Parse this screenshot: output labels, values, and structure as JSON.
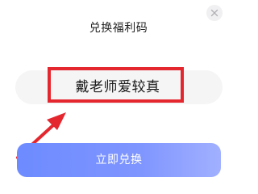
{
  "dialog": {
    "title": "兑换福利码",
    "close_icon": "close-icon"
  },
  "code_input": {
    "value": "戴老师爱较真"
  },
  "annotation": {
    "color": "#e4272f"
  },
  "redeem_button": {
    "label": "立即兑换",
    "color": "#7088ff"
  }
}
